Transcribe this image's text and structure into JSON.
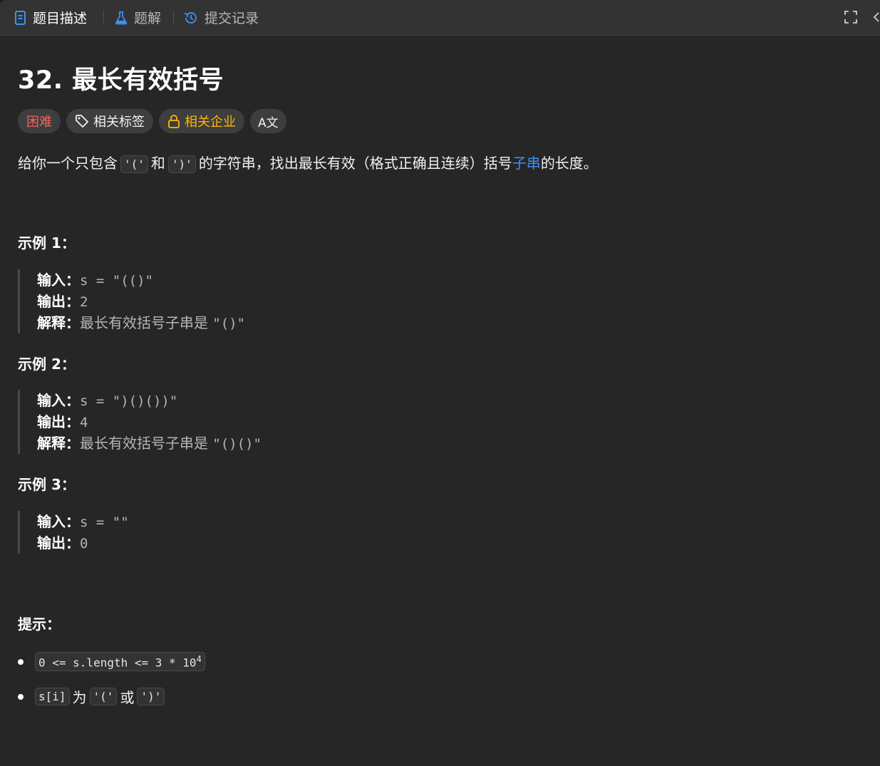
{
  "tabs": [
    {
      "label": "题目描述",
      "icon": "document-icon",
      "active": true
    },
    {
      "label": "题解",
      "icon": "flask-icon",
      "active": false
    },
    {
      "label": "提交记录",
      "icon": "history-icon",
      "active": false
    }
  ],
  "toolbar": {
    "fullscreen_icon": "fullscreen-icon",
    "collapse_icon": "chevron-left-icon"
  },
  "problem": {
    "title": "32. 最长有效括号",
    "difficulty": "困难",
    "tags_label": "相关标签",
    "company_label": "相关企业",
    "translate_label": "A文"
  },
  "description": {
    "p1": "给你一个只包含",
    "code1": "'('",
    "p2": "和",
    "code2": "')'",
    "p3": "的字符串，找出最长有效（格式正确且连续）括号",
    "link": "子串",
    "p4": "的长度。"
  },
  "examples": [
    {
      "title": "示例 1：",
      "input_key": "输入：",
      "input_val": "s = \"(()\"",
      "output_key": "输出：",
      "output_val": "2",
      "explain_key": "解释：",
      "explain_val": "最长有效括号子串是 ",
      "explain_code": "\"()\""
    },
    {
      "title": "示例 2：",
      "input_key": "输入：",
      "input_val": "s = \")()())\"",
      "output_key": "输出：",
      "output_val": "4",
      "explain_key": "解释：",
      "explain_val": "最长有效括号子串是 ",
      "explain_code": "\"()()\""
    },
    {
      "title": "示例 3：",
      "input_key": "输入：",
      "input_val": "s = \"\"",
      "output_key": "输出：",
      "output_val": "0"
    }
  ],
  "hints": {
    "title": "提示：",
    "h1_code": "0 <= s.length <= 3 * 10",
    "h1_sup": "4",
    "h2_code1": "s[i]",
    "h2_t1": "为",
    "h2_code2": "'('",
    "h2_t2": "或",
    "h2_code3": "')'"
  },
  "colors": {
    "hard": "#f8615c",
    "company": "#ffb700",
    "link": "#3c91f7",
    "active_tab_icon": "#3c91f7"
  }
}
